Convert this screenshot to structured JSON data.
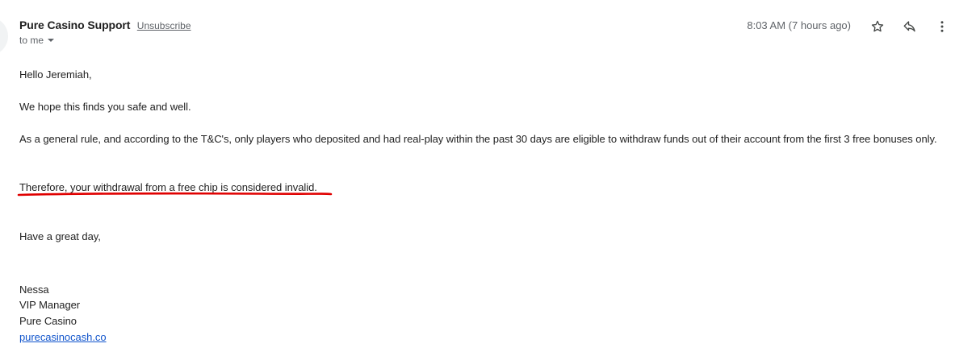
{
  "header": {
    "sender_name": "Pure Casino Support",
    "unsubscribe_label": "Unsubscribe",
    "to_label": "to me",
    "timestamp": "8:03 AM (7 hours ago)",
    "icons": [
      "star-icon",
      "reply-icon",
      "more-vert-icon"
    ]
  },
  "body": {
    "greeting": "Hello Jeremiah,",
    "line1": "We hope this finds you safe and well.",
    "line2": "As a general rule, and according to the T&C's, only players who deposited and had real-play within the past 30 days are eligible to withdraw funds out of their account from the first 3 free bonuses only.",
    "line3": "Therefore, your withdrawal from a free chip is considered invalid.",
    "closing": "Have a great day,"
  },
  "signature": {
    "name": "Nessa",
    "title": "VIP Manager",
    "company": "Pure Casino",
    "link": "purecasinocash.co"
  },
  "colors": {
    "underline_annotation": "#e00000",
    "link": "#1155cc",
    "muted": "#5f6368"
  }
}
